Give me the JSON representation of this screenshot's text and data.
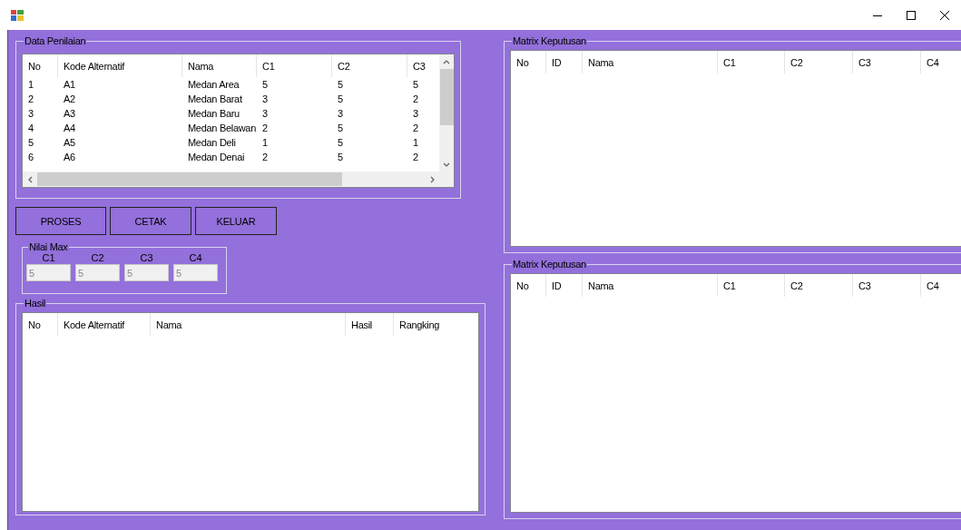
{
  "data_penilaian": {
    "title": "Data Penilaian",
    "columns": [
      "No",
      "Kode Alternatif",
      "Nama",
      "C1",
      "C2",
      "C3"
    ],
    "rows": [
      [
        "1",
        "A1",
        "Medan Area",
        "5",
        "5",
        "5"
      ],
      [
        "2",
        "A2",
        "Medan Barat",
        "3",
        "5",
        "2"
      ],
      [
        "3",
        "A3",
        "Medan Baru",
        "3",
        "3",
        "3"
      ],
      [
        "4",
        "A4",
        "Medan Belawan",
        "2",
        "5",
        "2"
      ],
      [
        "5",
        "A5",
        "Medan Deli",
        "1",
        "5",
        "1"
      ],
      [
        "6",
        "A6",
        "Medan Denai",
        "2",
        "5",
        "2"
      ]
    ]
  },
  "buttons": [
    "PROSES",
    "CETAK",
    "KELUAR"
  ],
  "nilai_max": {
    "title": "Nilai Max",
    "fields": [
      {
        "label": "C1",
        "value": "5",
        "disabled": true
      },
      {
        "label": "C2",
        "value": "5",
        "disabled": true
      },
      {
        "label": "C3",
        "value": "5",
        "disabled": true
      },
      {
        "label": "C4",
        "value": "5",
        "disabled": true
      }
    ]
  },
  "hasil": {
    "title": "Hasil",
    "columns": [
      "No",
      "Kode Alternatif",
      "Nama",
      "Hasil",
      "Rangking"
    ]
  },
  "matrix_tables": [
    {
      "title": "Matrix Keputusan",
      "columns": [
        "No",
        "ID",
        "Nama",
        "C1",
        "C2",
        "C3",
        "C4"
      ]
    },
    {
      "title": "Matrix Keputusan",
      "columns": [
        "No",
        "ID",
        "Nama",
        "C1",
        "C2",
        "C3",
        "C4"
      ]
    }
  ]
}
